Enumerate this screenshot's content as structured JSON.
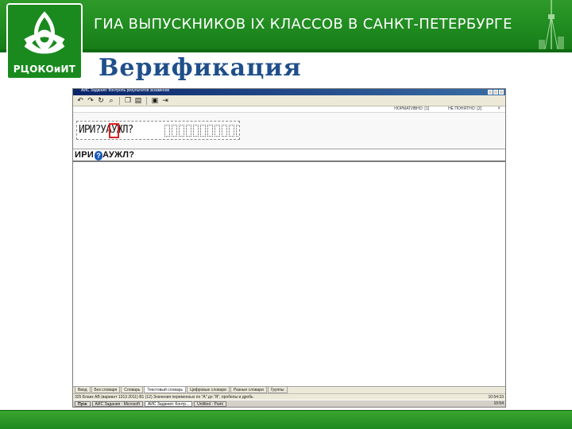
{
  "slide": {
    "logo_text": "РЦОКОиИТ",
    "title": "ГИА ВЫПУСКНИКОВ IX КЛАССОВ В САНКТ-ПЕТЕРБУРГЕ",
    "subtitle": "Верификация"
  },
  "app": {
    "window_title": "АИС Задания: Контроль результатов экзаменов",
    "toolbar": {
      "icons": [
        "undo-icon",
        "redo-icon",
        "refresh-icon",
        "search-icon",
        "copy-icon",
        "paste-icon",
        "save-icon",
        "exit-icon"
      ]
    },
    "status_line": {
      "left": "НОРМАТИВНО: [1]",
      "right": "НЕ ПОНЯТНО: [2]",
      "close": "×"
    },
    "scan_text": "ИРИ?УАУЖЛ?",
    "recognized": {
      "text_before": "ИРИ",
      "marker": "?",
      "text_after": "АУЖЛ?"
    },
    "tabs": [
      {
        "label": "Ввод",
        "active": false
      },
      {
        "label": "Без словаря",
        "active": false
      },
      {
        "label": "Словарь",
        "active": false
      },
      {
        "label": "Текстовый словарь",
        "active": true
      },
      {
        "label": "Цифровые словари",
        "active": false
      },
      {
        "label": "Разные словари",
        "active": false
      },
      {
        "label": "Группы",
        "active": false
      }
    ],
    "status_bar": {
      "left": "325 Бланк АВ (вариант 1313 2011)  В1 (12)  Значения переменных по \"А\" до \"Я\", пробелы и дробь",
      "right": "10:54:33"
    },
    "taskbar": {
      "start": "Пуск",
      "items": [
        {
          "label": "АИС Задания - Microsoft",
          "active": false
        },
        {
          "label": "АИС Задания: Контр...",
          "active": true
        },
        {
          "label": "Untitled - Paint",
          "active": false
        }
      ],
      "clock": "10:54"
    }
  },
  "colors": {
    "banner_green": "#1f8a1f",
    "subtitle_blue": "#1f4f8a",
    "highlight_red": "#e02020"
  }
}
